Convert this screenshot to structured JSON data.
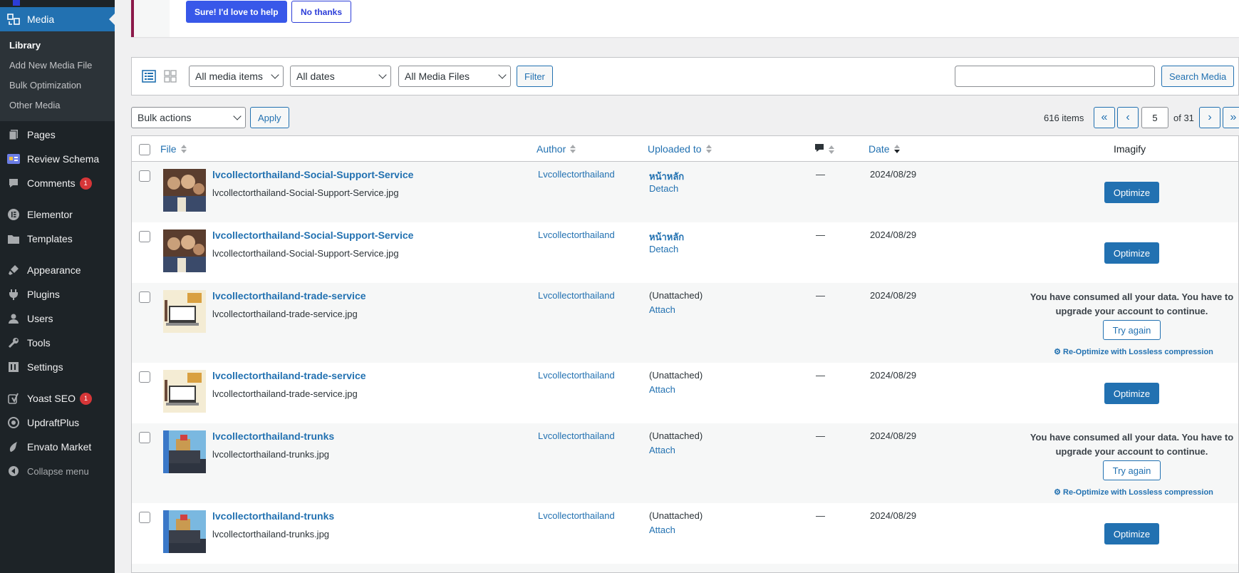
{
  "sidebar": {
    "media_label": "Media",
    "submenu": [
      "Library",
      "Add New Media File",
      "Bulk Optimization",
      "Other Media"
    ],
    "items": [
      {
        "label": "Pages",
        "icon": "pages-icon"
      },
      {
        "label": "Review Schema",
        "icon": "review-schema-icon"
      },
      {
        "label": "Comments",
        "icon": "comments-icon",
        "badge": "1"
      },
      {
        "label": "Elementor",
        "icon": "elementor-icon"
      },
      {
        "label": "Templates",
        "icon": "templates-icon"
      },
      {
        "label": "Appearance",
        "icon": "appearance-icon"
      },
      {
        "label": "Plugins",
        "icon": "plugins-icon"
      },
      {
        "label": "Users",
        "icon": "users-icon"
      },
      {
        "label": "Tools",
        "icon": "tools-icon"
      },
      {
        "label": "Settings",
        "icon": "settings-icon"
      },
      {
        "label": "Yoast SEO",
        "icon": "yoast-icon",
        "badge": "1"
      },
      {
        "label": "UpdraftPlus",
        "icon": "updraftplus-icon"
      },
      {
        "label": "Envato Market",
        "icon": "envato-icon"
      }
    ],
    "collapse_label": "Collapse menu"
  },
  "notice": {
    "primary_label": "Sure! I'd love to help",
    "secondary_label": "No thanks"
  },
  "filters": {
    "media_type": "All media items",
    "dates": "All dates",
    "files": "All Media Files",
    "filter_label": "Filter",
    "search_label": "Search Media"
  },
  "tablenav": {
    "bulk_actions": "Bulk actions",
    "apply_label": "Apply",
    "items_count": "616 items",
    "first": "«",
    "prev": "‹",
    "current_page": "5",
    "of_total": "of 31",
    "next": "›",
    "last": "»"
  },
  "columns": {
    "file": "File",
    "author": "Author",
    "uploaded_to": "Uploaded to",
    "date": "Date",
    "imagify": "Imagify"
  },
  "rows": [
    {
      "title": "lvcollectorthailand-Social-Support-Service",
      "filename": "lvcollectorthailand-Social-Support-Service.jpg",
      "author": "Lvcollectorthailand",
      "uploaded_to": "หน้าหลัก",
      "uploaded_action": "Detach",
      "comments": "—",
      "date": "2024/08/29",
      "optimize_label": "Optimize"
    },
    {
      "title": "lvcollectorthailand-Social-Support-Service",
      "filename": "lvcollectorthailand-Social-Support-Service.jpg",
      "author": "Lvcollectorthailand",
      "uploaded_to": "หน้าหลัก",
      "uploaded_action": "Detach",
      "comments": "—",
      "date": "2024/08/29",
      "optimize_label": "Optimize"
    },
    {
      "title": "lvcollectorthailand-trade-service",
      "filename": "lvcollectorthailand-trade-service.jpg",
      "author": "Lvcollectorthailand",
      "uploaded_to": "(Unattached)",
      "uploaded_action": "Attach",
      "comments": "—",
      "date": "2024/08/29",
      "consumed_text": "You have consumed all your data. You have to upgrade your account to continue.",
      "try_again_label": "Try again",
      "reoptimize_label": "Re-Optimize with Lossless compression"
    },
    {
      "title": "lvcollectorthailand-trade-service",
      "filename": "lvcollectorthailand-trade-service.jpg",
      "author": "Lvcollectorthailand",
      "uploaded_to": "(Unattached)",
      "uploaded_action": "Attach",
      "comments": "—",
      "date": "2024/08/29",
      "optimize_label": "Optimize"
    },
    {
      "title": "lvcollectorthailand-trunks",
      "filename": "lvcollectorthailand-trunks.jpg",
      "author": "Lvcollectorthailand",
      "uploaded_to": "(Unattached)",
      "uploaded_action": "Attach",
      "comments": "—",
      "date": "2024/08/29",
      "consumed_text": "You have consumed all your data. You have to upgrade your account to continue.",
      "try_again_label": "Try again",
      "reoptimize_label": "Re-Optimize with Lossless compression"
    },
    {
      "title": "lvcollectorthailand-trunks",
      "filename": "lvcollectorthailand-trunks.jpg",
      "author": "Lvcollectorthailand",
      "uploaded_to": "(Unattached)",
      "uploaded_action": "Attach",
      "comments": "—",
      "date": "2024/08/29",
      "optimize_label": "Optimize"
    }
  ],
  "colors": {
    "sidebar_bg": "#1d2327",
    "accent": "#2271b1",
    "notice_primary": "#3858e9",
    "badge": "#d63638"
  }
}
